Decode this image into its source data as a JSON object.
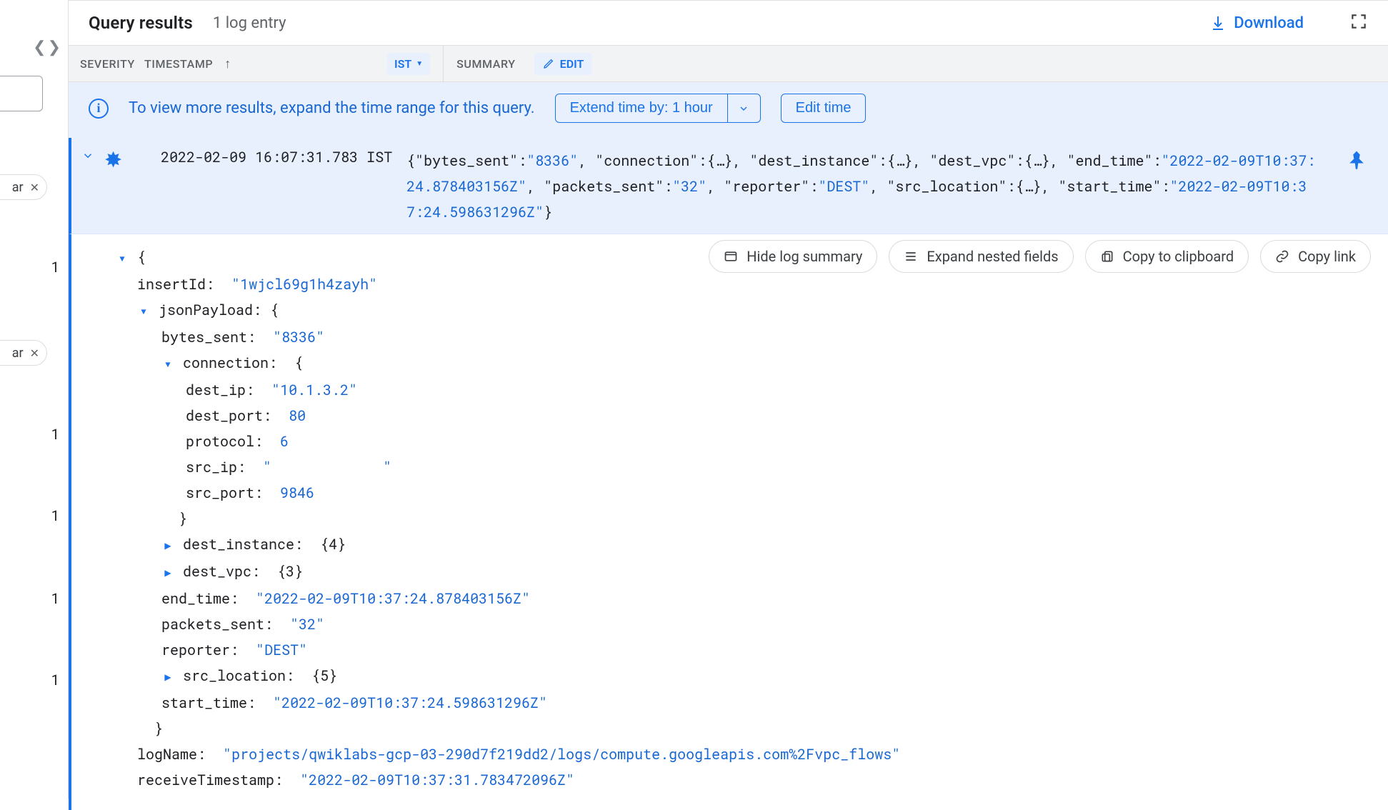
{
  "results": {
    "title": "Query results",
    "count_label": "1 log entry",
    "download_label": "Download"
  },
  "columns": {
    "severity": "SEVERITY",
    "timestamp": "TIMESTAMP",
    "tz": "IST",
    "summary": "SUMMARY",
    "edit": "EDIT"
  },
  "banner": {
    "text": "To view more results, expand the time range for this query.",
    "extend": "Extend time by: 1 hour",
    "edit_time": "Edit time"
  },
  "row": {
    "timestamp": "2022-02-09 16:07:31.783 IST",
    "summary_parts": [
      {
        "t": "brace",
        "v": "{"
      },
      {
        "t": "key",
        "v": "\"bytes_sent\""
      },
      {
        "t": "colon",
        "v": ":"
      },
      {
        "t": "str",
        "v": "\"8336\""
      },
      {
        "t": "sep",
        "v": ", "
      },
      {
        "t": "key",
        "v": "\"connection\""
      },
      {
        "t": "colon",
        "v": ":"
      },
      {
        "t": "brace",
        "v": "{…}"
      },
      {
        "t": "sep",
        "v": ", "
      },
      {
        "t": "key",
        "v": "\"dest_instance\""
      },
      {
        "t": "colon",
        "v": ":"
      },
      {
        "t": "brace",
        "v": "{…}"
      },
      {
        "t": "sep",
        "v": ", "
      },
      {
        "t": "key",
        "v": "\"dest_vpc\""
      },
      {
        "t": "colon",
        "v": ":"
      },
      {
        "t": "brace",
        "v": "{…}"
      },
      {
        "t": "sep",
        "v": ", "
      },
      {
        "t": "key",
        "v": "\"end_time\""
      },
      {
        "t": "colon",
        "v": ":"
      },
      {
        "t": "str",
        "v": "\"2022-02-09T10:37:24.878403156Z\""
      },
      {
        "t": "sep",
        "v": ", "
      },
      {
        "t": "key",
        "v": "\"packets_sent\""
      },
      {
        "t": "colon",
        "v": ":"
      },
      {
        "t": "str",
        "v": "\"32\""
      },
      {
        "t": "sep",
        "v": ", "
      },
      {
        "t": "key",
        "v": "\"reporter\""
      },
      {
        "t": "colon",
        "v": ":"
      },
      {
        "t": "str",
        "v": "\"DEST\""
      },
      {
        "t": "sep",
        "v": ", "
      },
      {
        "t": "key",
        "v": "\"src_location\""
      },
      {
        "t": "colon",
        "v": ":"
      },
      {
        "t": "brace",
        "v": "{…}"
      },
      {
        "t": "sep",
        "v": ", "
      },
      {
        "t": "key",
        "v": "\"start_time\""
      },
      {
        "t": "colon",
        "v": ":"
      },
      {
        "t": "str",
        "v": "\"2022-02-09T10:37:24.598631296Z\""
      },
      {
        "t": "brace",
        "v": "}"
      }
    ]
  },
  "actions": {
    "hide_summary": "Hide log summary",
    "expand_nested": "Expand nested fields",
    "copy_clipboard": "Copy to clipboard",
    "copy_link": "Copy link"
  },
  "log": {
    "insertId": "1wjcl69g1h4zayh",
    "jsonPayload": {
      "bytes_sent": "8336",
      "connection": {
        "dest_ip": "10.1.3.2",
        "dest_port": 80,
        "protocol": 6,
        "src_ip": "",
        "src_port": 9846
      },
      "dest_instance_count": 4,
      "dest_vpc_count": 3,
      "end_time": "2022-02-09T10:37:24.878403156Z",
      "packets_sent": "32",
      "reporter": "DEST",
      "src_location_count": 5,
      "start_time": "2022-02-09T10:37:24.598631296Z"
    },
    "logName": "projects/qwiklabs-gcp-03-290d7f219dd2/logs/compute.googleapis.com%2Fvpc_flows",
    "receiveTimestamp": "2022-02-09T10:37:31.783472096Z"
  },
  "left_strip": {
    "pill_suffix": "ar",
    "counts": [
      "1",
      "1",
      "1",
      "1",
      "1"
    ]
  }
}
